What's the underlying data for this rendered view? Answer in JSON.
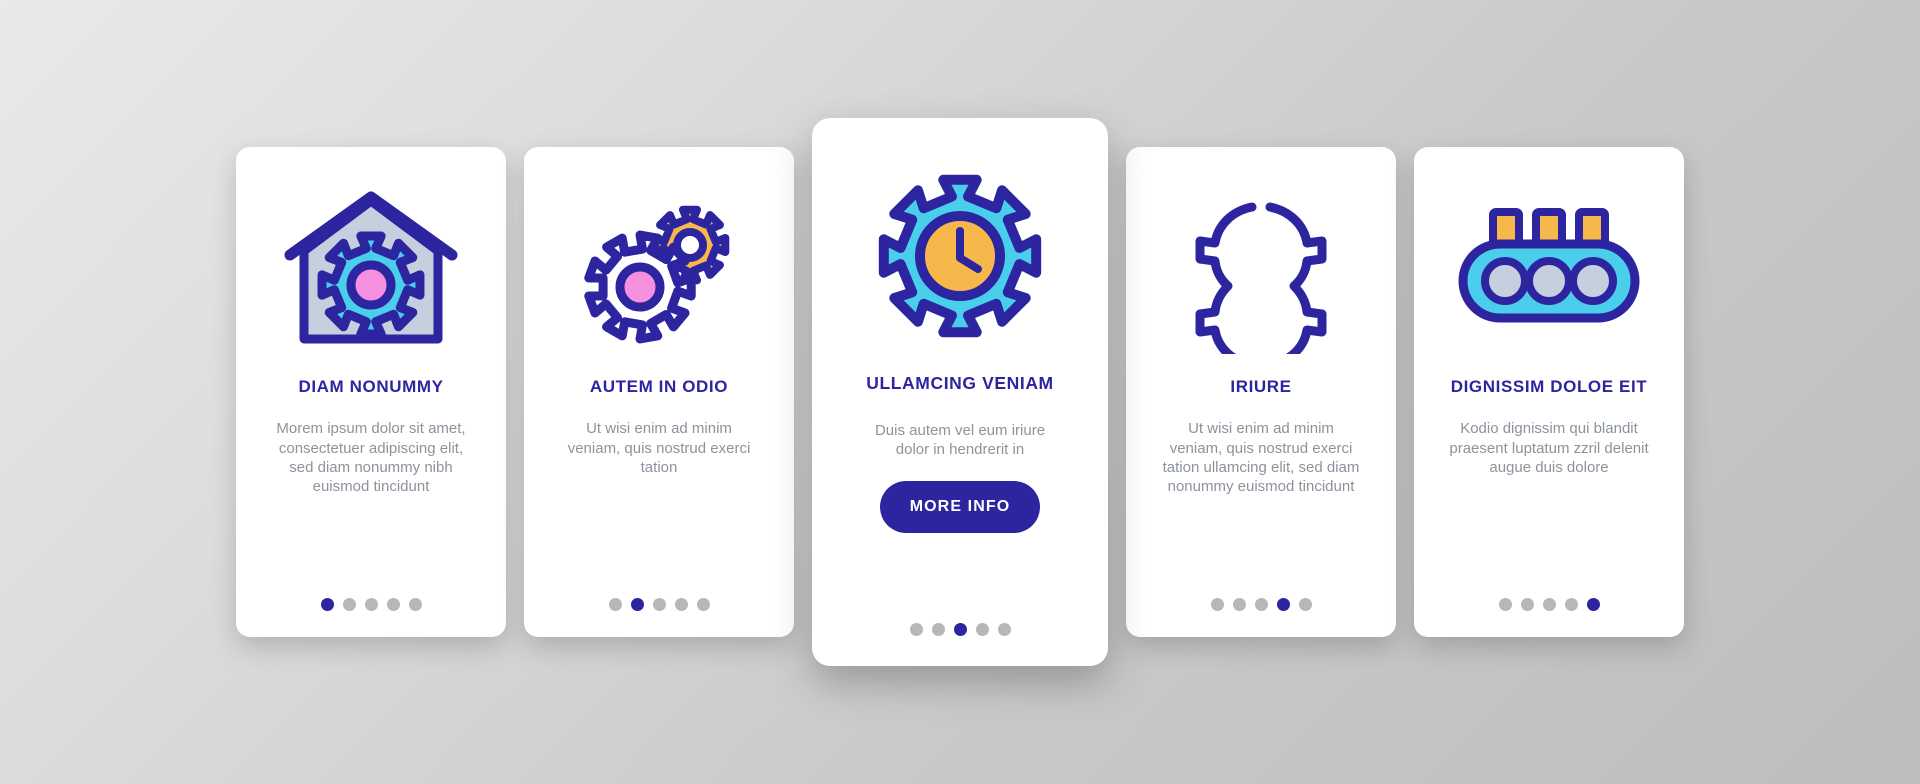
{
  "theme": {
    "background_gradient_from": "#e9e9e9",
    "background_gradient_to": "#bdbdbd",
    "card_background": "#ffffff",
    "accent_indigo": "#2d25a0",
    "accent_cyan": "#4bcdec",
    "accent_pink": "#f78fe0",
    "accent_amber": "#f7b84b",
    "accent_bluegray": "#c5cfdd",
    "body_text_color": "#8b939c",
    "dot_inactive_color": "#b6b6bb"
  },
  "cards": [
    {
      "icon": "house-gear-icon",
      "title": "DIAM NONUMMY",
      "body": "Morem ipsum dolor sit amet, consectetuer adipiscing elit, sed diam nonummy nibh euismod tincidunt",
      "dots_total": 5,
      "dot_active_index": 0,
      "featured": false
    },
    {
      "icon": "two-gears-icon",
      "title": "AUTEM IN ODIO",
      "body": "Ut wisi enim ad minim veniam, quis nostrud exerci tation",
      "dots_total": 5,
      "dot_active_index": 1,
      "featured": false
    },
    {
      "icon": "gear-clock-icon",
      "title": "ULLAMCING VENIAM",
      "body": "Duis autem vel eum iriure dolor in hendrerit in",
      "button_label": "MORE INFO",
      "dots_total": 5,
      "dot_active_index": 2,
      "featured": true
    },
    {
      "icon": "gear-halves-icon",
      "title": "IRIURE",
      "body": "Ut wisi enim ad minim veniam, quis nostrud exerci tation ullamcing elit, sed diam nonummy euismod tincidunt",
      "dots_total": 5,
      "dot_active_index": 3,
      "featured": false
    },
    {
      "icon": "conveyor-rollers-icon",
      "title": "DIGNISSIM DOLOE EIT",
      "body": "Kodio dignissim qui blandit praesent luptatum zzril delenit augue duis dolore",
      "dots_total": 5,
      "dot_active_index": 4,
      "featured": false
    }
  ]
}
